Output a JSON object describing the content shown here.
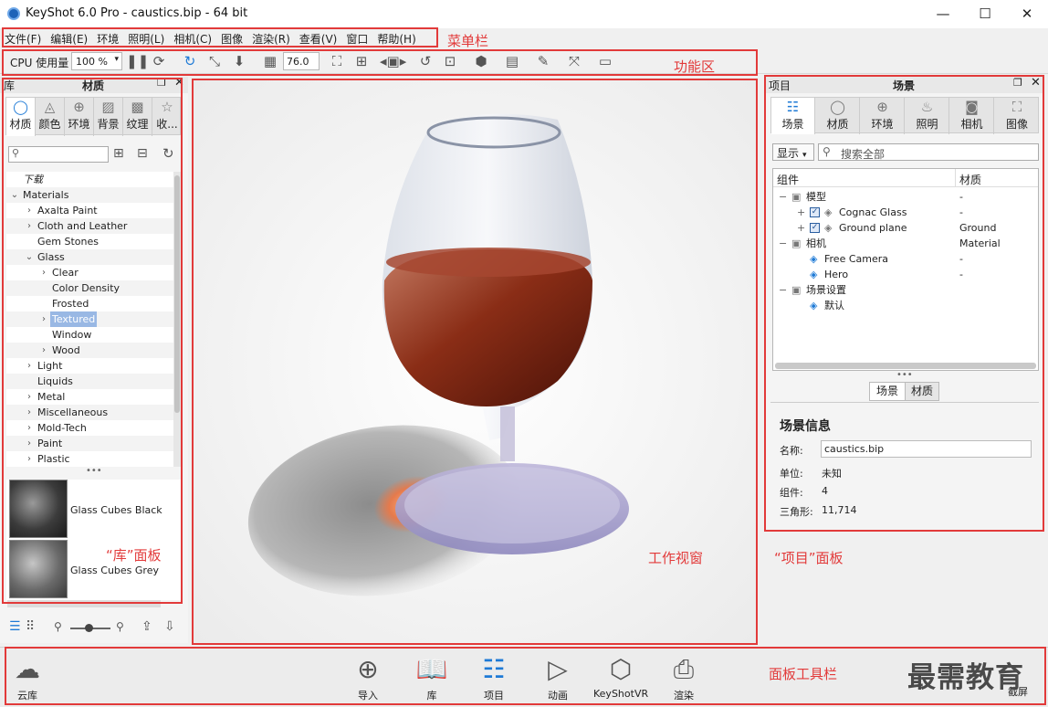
{
  "window": {
    "title": "KeyShot 6.0 Pro  - caustics.bip  - 64 bit",
    "minimize": "—",
    "maximize": "☐",
    "close": "✕"
  },
  "menu": [
    "文件(F)",
    "编辑(E)",
    "环境",
    "照明(L)",
    "相机(C)",
    "图像",
    "渲染(R)",
    "查看(V)",
    "窗口",
    "帮助(H)"
  ],
  "toolbar": {
    "cpu_label": "CPU 使用量",
    "cpu_value": "100 %",
    "fov_value": "76.0"
  },
  "annotations": {
    "menubar": "菜单栏",
    "toolbar": "功能区",
    "library": "“库”面板",
    "viewport": "工作视窗",
    "project": "“项目”面板",
    "panelbar": "面板工具栏"
  },
  "library": {
    "header_left": "库",
    "header_title": "材质",
    "tabs": [
      "材质",
      "颜色",
      "环境",
      "背景",
      "纹理",
      "收..."
    ],
    "tree": [
      {
        "label": "下载",
        "level": 0,
        "arrow": ""
      },
      {
        "label": "Materials",
        "level": 0,
        "arrow": "⌄"
      },
      {
        "label": "Axalta Paint",
        "level": 1,
        "arrow": "›"
      },
      {
        "label": "Cloth and Leather",
        "level": 1,
        "arrow": "›"
      },
      {
        "label": "Gem Stones",
        "level": 1,
        "arrow": ""
      },
      {
        "label": "Glass",
        "level": 1,
        "arrow": "⌄"
      },
      {
        "label": "Clear",
        "level": 2,
        "arrow": "›"
      },
      {
        "label": "Color Density",
        "level": 2,
        "arrow": ""
      },
      {
        "label": "Frosted",
        "level": 2,
        "arrow": ""
      },
      {
        "label": "Textured",
        "level": 2,
        "arrow": "›",
        "selected": true
      },
      {
        "label": "Window",
        "level": 2,
        "arrow": ""
      },
      {
        "label": "Wood",
        "level": 2,
        "arrow": "›"
      },
      {
        "label": "Light",
        "level": 1,
        "arrow": "›"
      },
      {
        "label": "Liquids",
        "level": 1,
        "arrow": ""
      },
      {
        "label": "Metal",
        "level": 1,
        "arrow": "›"
      },
      {
        "label": "Miscellaneous",
        "level": 1,
        "arrow": "›"
      },
      {
        "label": "Mold-Tech",
        "level": 1,
        "arrow": "›"
      },
      {
        "label": "Paint",
        "level": 1,
        "arrow": "›"
      },
      {
        "label": "Plastic",
        "level": 1,
        "arrow": "›"
      }
    ],
    "thumbs": [
      "Glass Cubes Black",
      "Glass Cubes Grey"
    ]
  },
  "project": {
    "header_left": "项目",
    "header_title": "场景",
    "tabs": [
      "场景",
      "材质",
      "环境",
      "照明",
      "相机",
      "图像"
    ],
    "show_button": "显示",
    "search_placeholder": "搜索全部",
    "col_component": "组件",
    "col_material": "材质",
    "tree": [
      {
        "label": "模型",
        "value": "-",
        "indent": 0,
        "expander": "−",
        "check": false
      },
      {
        "label": "Cognac Glass",
        "value": "-",
        "indent": 1,
        "expander": "+",
        "check": true
      },
      {
        "label": "Ground plane",
        "value": "Ground Material",
        "indent": 1,
        "expander": "+",
        "check": true
      },
      {
        "label": "相机",
        "value": "",
        "indent": 0,
        "expander": "−",
        "check": false
      },
      {
        "label": "Free Camera",
        "value": "-",
        "indent": 1,
        "expander": "",
        "check": false
      },
      {
        "label": "Hero",
        "value": "-",
        "indent": 1,
        "expander": "",
        "check": false
      },
      {
        "label": "场景设置",
        "value": "",
        "indent": 0,
        "expander": "−",
        "check": false
      },
      {
        "label": "默认",
        "value": "",
        "indent": 1,
        "expander": "",
        "check": false
      }
    ],
    "subtabs": [
      "场景",
      "材质"
    ],
    "info_title": "场景信息",
    "name_label": "名称:",
    "name_value": "caustics.bip",
    "unit_label": "单位:",
    "unit_value": "未知",
    "comp_label": "组件:",
    "comp_value": "4",
    "tri_label": "三角形:",
    "tri_value": "11,714"
  },
  "panelbar": {
    "cloud": "云库",
    "items": [
      "导入",
      "库",
      "项目",
      "动画",
      "KeyShotVR",
      "渲染"
    ],
    "screenshot": "截屏"
  },
  "watermark": "最需教育",
  "colors": {
    "accent": "#1e7ad6",
    "annotation": "#e23a3a",
    "selection": "#99b8e4"
  }
}
